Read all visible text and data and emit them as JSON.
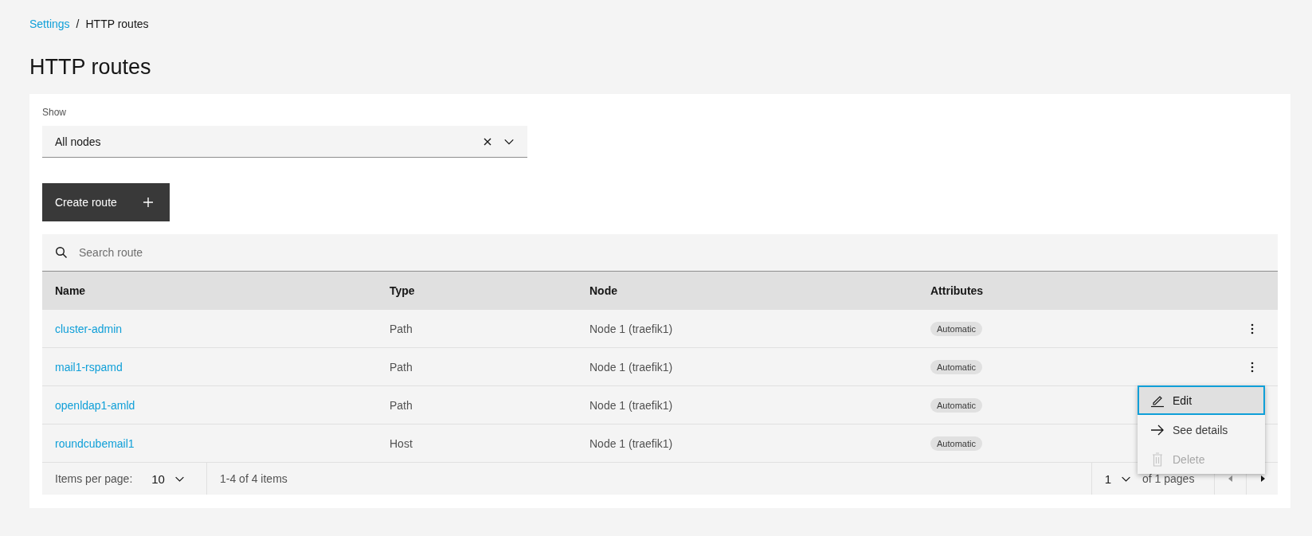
{
  "breadcrumb": [
    {
      "label": "Settings",
      "kind": "link"
    },
    {
      "label": "HTTP routes",
      "kind": "current"
    }
  ],
  "breadcrumb_separator": "/",
  "page_title": "HTTP routes",
  "filter": {
    "label": "Show",
    "value": "All nodes"
  },
  "create_button": {
    "label": "Create route"
  },
  "search": {
    "placeholder": "Search route"
  },
  "table": {
    "columns": [
      "Name",
      "Type",
      "Node",
      "Attributes"
    ],
    "rows": [
      {
        "name": "cluster-admin",
        "type": "Path",
        "node": "Node 1 (traefik1)",
        "attributes": [
          "Automatic"
        ],
        "menu_open": false
      },
      {
        "name": "mail1-rspamd",
        "type": "Path",
        "node": "Node 1 (traefik1)",
        "attributes": [
          "Automatic"
        ],
        "menu_open": true
      },
      {
        "name": "openldap1-amld",
        "type": "Path",
        "node": "Node 1 (traefik1)",
        "attributes": [
          "Automatic"
        ],
        "menu_open": false
      },
      {
        "name": "roundcubemail1",
        "type": "Host",
        "node": "Node 1 (traefik1)",
        "attributes": [
          "Automatic"
        ],
        "menu_open": false
      }
    ]
  },
  "row_menu": {
    "items": [
      {
        "label": "Edit",
        "kind": "edit",
        "selected": true,
        "disabled": false
      },
      {
        "label": "See details",
        "kind": "details",
        "selected": false,
        "disabled": false
      },
      {
        "label": "Delete",
        "kind": "delete",
        "selected": false,
        "disabled": true
      }
    ]
  },
  "pagination": {
    "items_per_page_label": "Items per page:",
    "items_per_page": "10",
    "range": "1-4 of 4 items",
    "page": "1",
    "pages": "of 1 pages"
  }
}
